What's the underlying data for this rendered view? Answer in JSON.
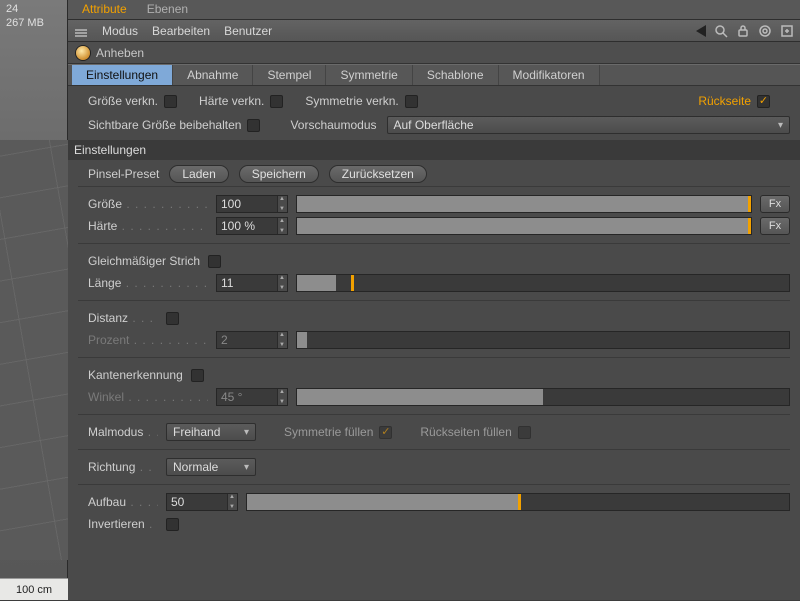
{
  "viewport": {
    "line1": "24",
    "line2": "267 MB",
    "ruler": "100 cm"
  },
  "top_tabs": {
    "attribute": "Attribute",
    "ebenen": "Ebenen"
  },
  "toolbar": {
    "modus": "Modus",
    "bearbeiten": "Bearbeiten",
    "benutzer": "Benutzer"
  },
  "tool": {
    "name": "Anheben"
  },
  "sub_tabs": {
    "einstellungen": "Einstellungen",
    "abnahme": "Abnahme",
    "stempel": "Stempel",
    "symmetrie": "Symmetrie",
    "schablone": "Schablone",
    "modifikatoren": "Modifikatoren"
  },
  "ck": {
    "groesse_verkn": "Größe verkn.",
    "haerte_verkn": "Härte verkn.",
    "symmetrie_verkn": "Symmetrie verkn.",
    "rueckseite": "Rückseite",
    "sichtbare_groesse": "Sichtbare Größe beibehalten",
    "vorschaumodus": "Vorschaumodus",
    "vorschaumodus_value": "Auf Oberfläche"
  },
  "section": {
    "einstellungen": "Einstellungen"
  },
  "preset": {
    "label": "Pinsel-Preset",
    "laden": "Laden",
    "speichern": "Speichern",
    "zuruecksetzen": "Zurücksetzen"
  },
  "params": {
    "groesse": {
      "label": "Größe",
      "value": "100",
      "fill": 100,
      "mark": 100
    },
    "haerte": {
      "label": "Härte",
      "value": "100 %",
      "fill": 100,
      "mark": 100
    },
    "gleichmaessiger_strich": "Gleichmäßiger Strich",
    "laenge": {
      "label": "Länge",
      "value": "11",
      "fill": 8,
      "mark": 11
    },
    "distanz": {
      "label": "Distanz"
    },
    "prozent": {
      "label": "Prozent",
      "value": "2",
      "fill": 2
    },
    "kantenerkennung": "Kantenerkennung",
    "winkel": {
      "label": "Winkel",
      "value": "45 °",
      "fill": 50
    },
    "malmodus": {
      "label": "Malmodus",
      "value": "Freihand"
    },
    "symmetrie_fuellen": "Symmetrie füllen",
    "rueckseiten_fuellen": "Rückseiten füllen",
    "richtung": {
      "label": "Richtung",
      "value": "Normale"
    },
    "aufbau": {
      "label": "Aufbau",
      "value": "50",
      "fill": 50,
      "mark": 50
    },
    "invertieren": "Invertieren",
    "fx": "Fx"
  }
}
